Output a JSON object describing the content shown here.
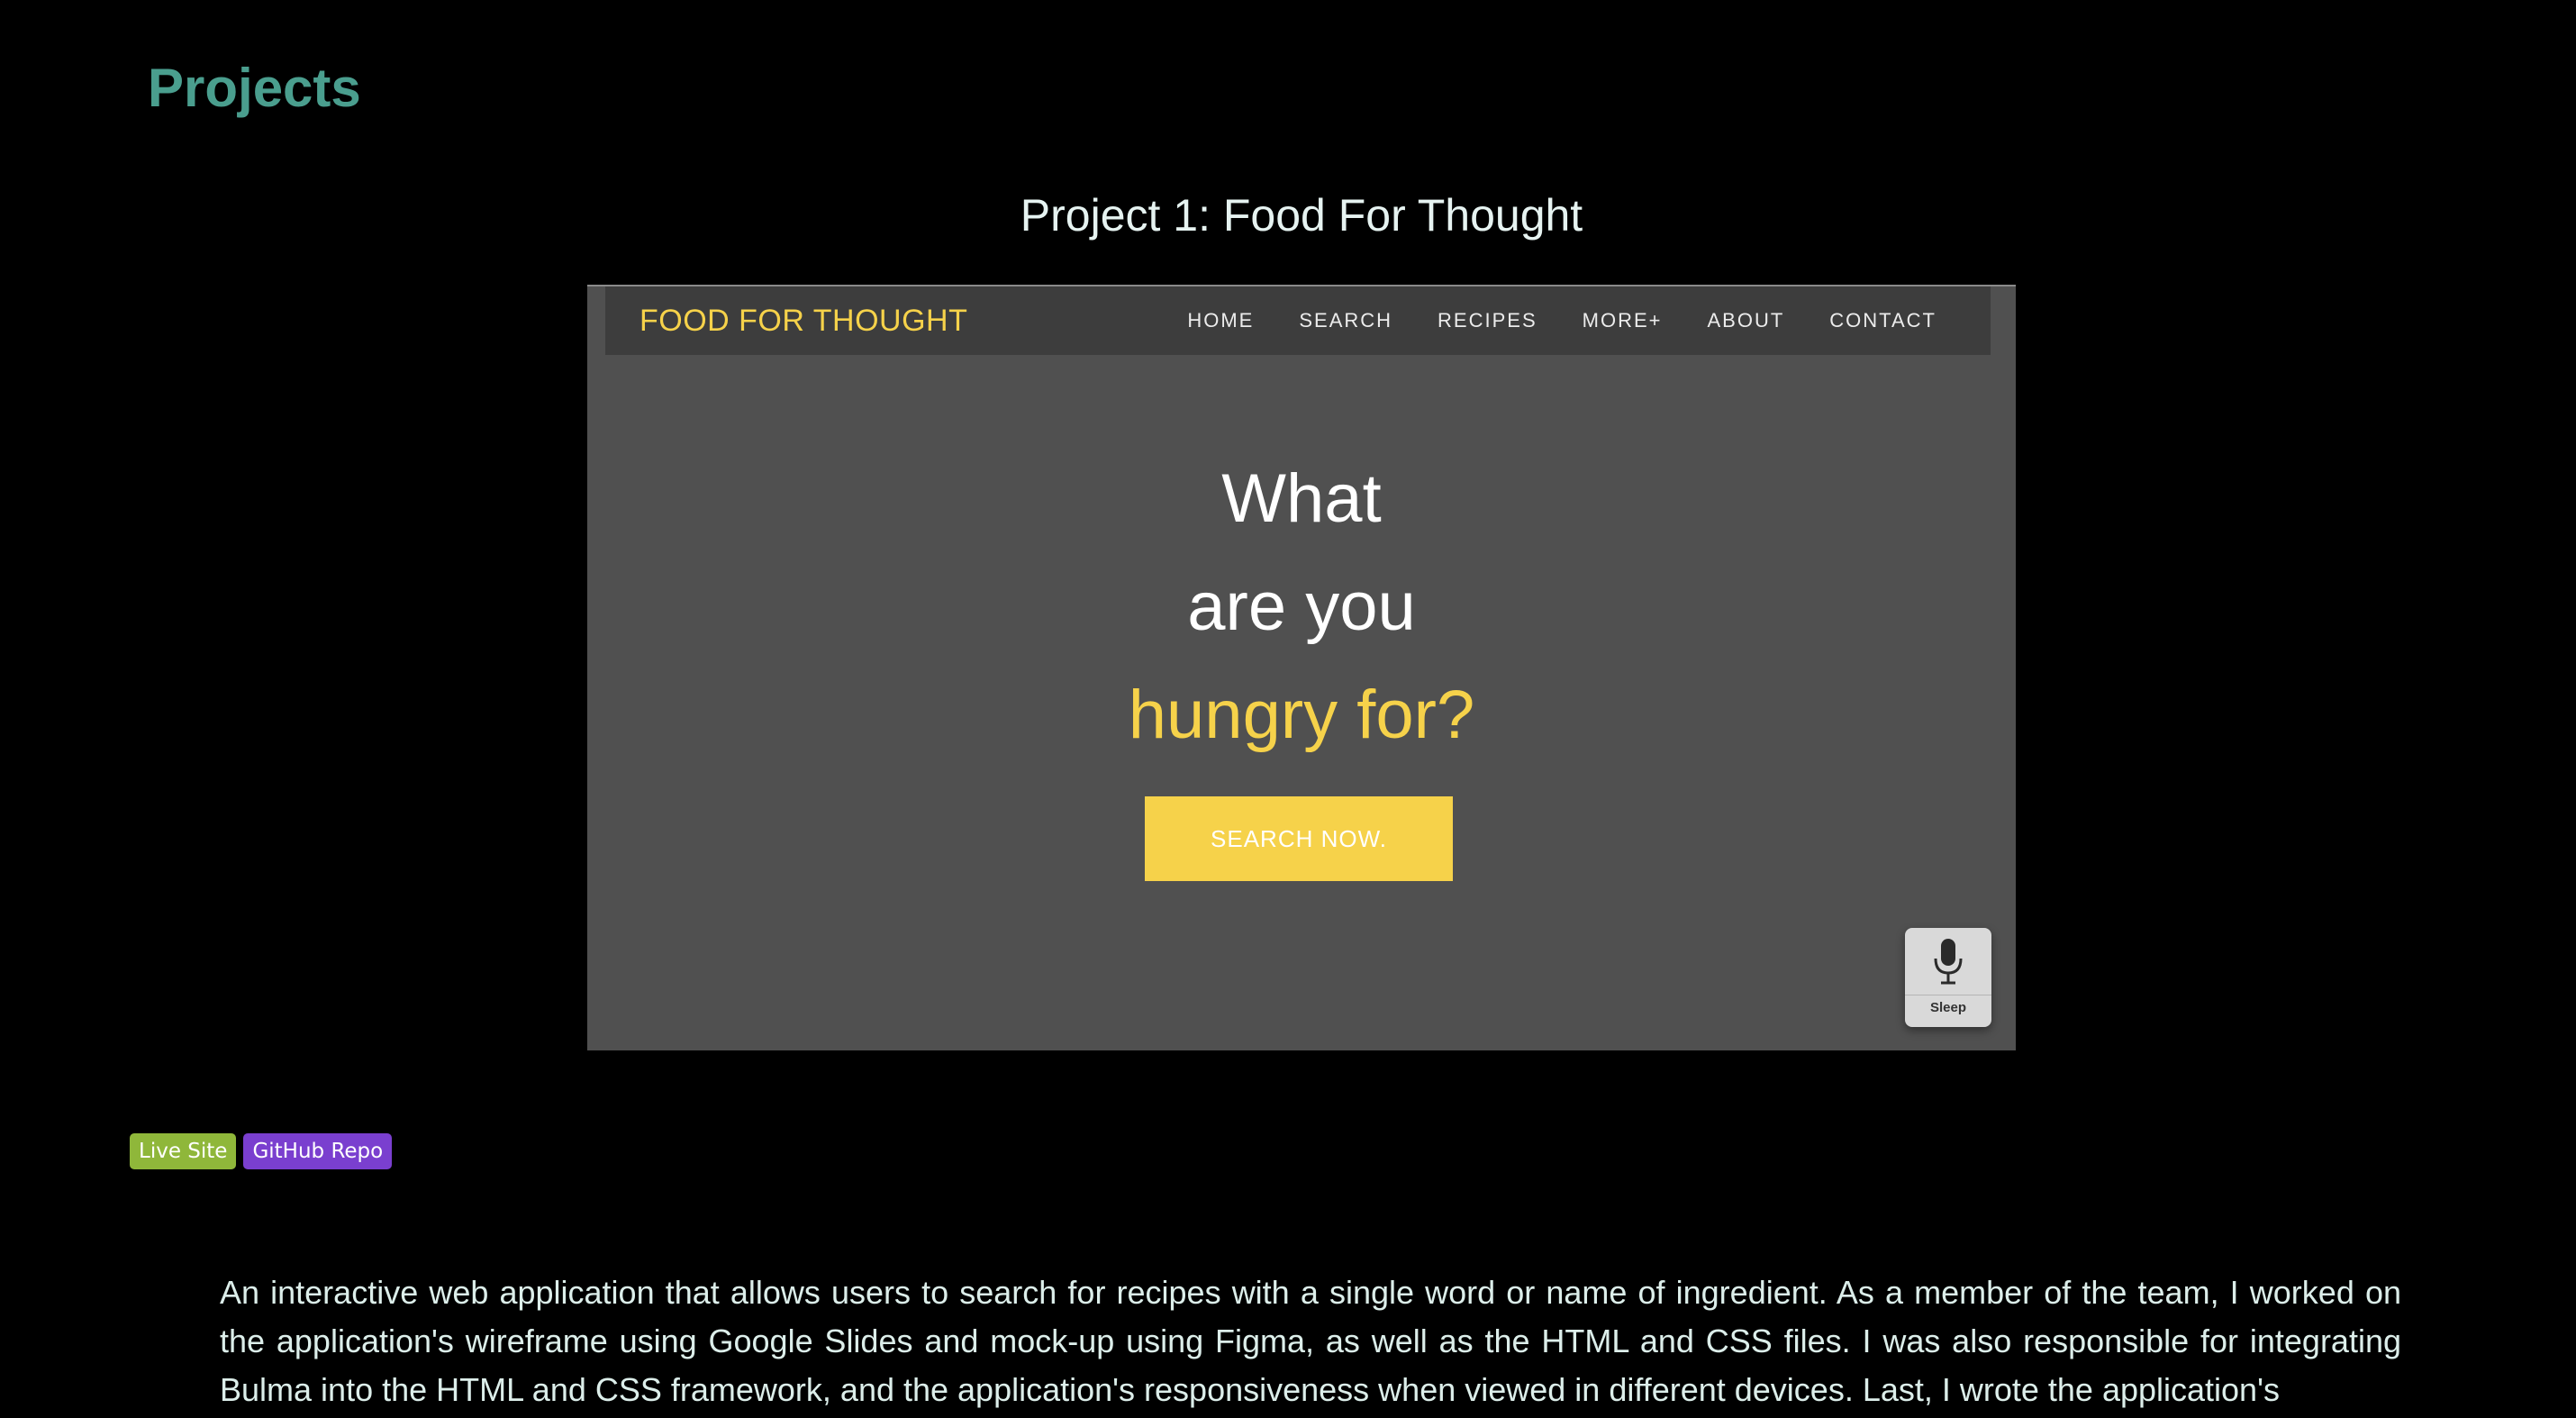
{
  "section": {
    "heading": "Projects"
  },
  "project": {
    "title": "Project 1: Food For Thought",
    "screenshot": {
      "brand": "FOOD FOR THOUGHT",
      "nav": [
        "HOME",
        "SEARCH",
        "RECIPES",
        "MORE+",
        "ABOUT",
        "CONTACT"
      ],
      "hero_line1": "What",
      "hero_line2": "are you",
      "hero_line3": "hungry for?",
      "cta_label": "SEARCH NOW.",
      "mic_label": "Sleep",
      "mic_icon": "microphone-icon"
    },
    "badges": {
      "live_site": "Live Site",
      "github_repo": "GitHub Repo"
    },
    "description": "An interactive web application that allows users to search for recipes with a single word or name of ingredient. As a member of the team, I worked on the application's wireframe using Google Slides and mock-up using Figma, as well as the HTML and CSS files. I was also responsible for integrating Bulma into the HTML and CSS framework, and the application's responsiveness when viewed in different devices. Last, I wrote the application's"
  },
  "colors": {
    "background": "#000000",
    "heading": "#4a9e8e",
    "brand_yellow": "#f6d24a",
    "live_badge": "#8fb73a",
    "github_badge": "#7a3fcf"
  }
}
